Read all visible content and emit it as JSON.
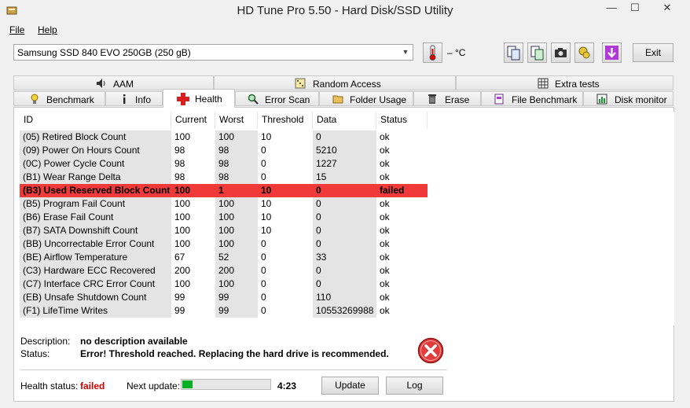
{
  "window": {
    "title": "HD Tune Pro 5.50 - Hard Disk/SSD Utility",
    "minimize": "—",
    "maximize": "☐",
    "close": "✕"
  },
  "menu": {
    "file": "File",
    "help": "Help"
  },
  "toolbar": {
    "drive": "Samsung SSD 840 EVO 250GB (250 gB)",
    "temperature": "– °C",
    "exit_label": "Exit"
  },
  "tabs": {
    "top": [
      {
        "label": "AAM",
        "icon": "speaker-icon"
      },
      {
        "label": "Random Access",
        "icon": "dice-icon"
      },
      {
        "label": "Extra tests",
        "icon": "grid-icon"
      }
    ],
    "bottom": [
      {
        "label": "Benchmark",
        "icon": "bulb-icon"
      },
      {
        "label": "Info",
        "icon": "info-icon"
      },
      {
        "label": "Health",
        "icon": "red-cross-icon"
      },
      {
        "label": "Error Scan",
        "icon": "magnifier-icon"
      },
      {
        "label": "Folder Usage",
        "icon": "folder-icon"
      },
      {
        "label": "Erase",
        "icon": "trash-icon"
      },
      {
        "label": "File Benchmark",
        "icon": "file-icon"
      },
      {
        "label": "Disk monitor",
        "icon": "chart-icon"
      }
    ],
    "active": "Health"
  },
  "health_table": {
    "columns": [
      "ID",
      "Current",
      "Worst",
      "Threshold",
      "Data",
      "Status"
    ],
    "rows": [
      [
        "(05) Retired Block Count",
        "100",
        "100",
        "10",
        "0",
        "ok"
      ],
      [
        "(09) Power On Hours Count",
        "98",
        "98",
        "0",
        "5210",
        "ok"
      ],
      [
        "(0C) Power Cycle Count",
        "98",
        "98",
        "0",
        "1227",
        "ok"
      ],
      [
        "(B1) Wear Range Delta",
        "98",
        "98",
        "0",
        "15",
        "ok"
      ],
      [
        "(B3) Used Reserved Block Count",
        "100",
        "1",
        "10",
        "0",
        "failed"
      ],
      [
        "(B5) Program Fail Count",
        "100",
        "100",
        "10",
        "0",
        "ok"
      ],
      [
        "(B6) Erase Fail Count",
        "100",
        "100",
        "10",
        "0",
        "ok"
      ],
      [
        "(B7) SATA Downshift Count",
        "100",
        "100",
        "10",
        "0",
        "ok"
      ],
      [
        "(BB) Uncorrectable Error Count",
        "100",
        "100",
        "0",
        "0",
        "ok"
      ],
      [
        "(BE) Airflow Temperature",
        "67",
        "52",
        "0",
        "33",
        "ok"
      ],
      [
        "(C3) Hardware ECC Recovered",
        "200",
        "200",
        "0",
        "0",
        "ok"
      ],
      [
        "(C7) Interface CRC Error Count",
        "100",
        "100",
        "0",
        "0",
        "ok"
      ],
      [
        "(EB) Unsafe Shutdown Count",
        "99",
        "99",
        "0",
        "110",
        "ok"
      ],
      [
        "(F1) LifeTime Writes",
        "99",
        "99",
        "0",
        "10553269988",
        "ok"
      ]
    ]
  },
  "details": {
    "description_label": "Description:",
    "description_value": "no description available",
    "status_label": "Status:",
    "status_value": "Error! Threshold reached. Replacing the hard drive is recommended."
  },
  "footer": {
    "health_label": "Health status:",
    "health_value": "failed",
    "next_update_label": "Next update:",
    "progress": 0.12,
    "timer": "4:23",
    "update_button": "Update",
    "log_button": "Log"
  },
  "colors": {
    "failed_row": "#f03a3a",
    "failed_text": "#d10000",
    "progress": "#06b025"
  }
}
